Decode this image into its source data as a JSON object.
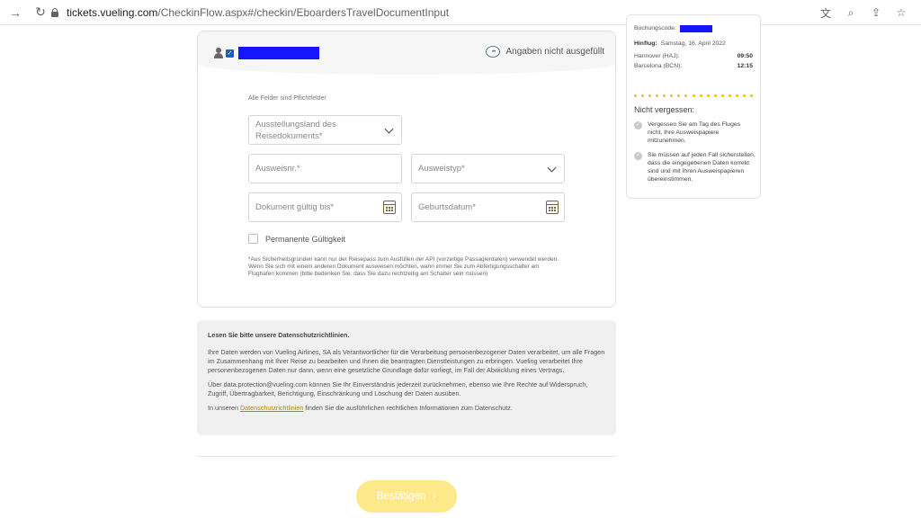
{
  "browser": {
    "url_domain": "tickets.vueling.com",
    "url_path": "/CheckinFlow.aspx#/checkin/EboardersTravelDocumentInput"
  },
  "passenger_card": {
    "status_text": "Angaben nicht ausgefüllt",
    "required_note": "Alle Felder sind Pflichtfelder",
    "fields": {
      "issuing_country": "Ausstellungsland des Reisedokuments*",
      "id_number": "Ausweisnr.*",
      "id_type": "Ausweistyp*",
      "valid_until": "Dokument gültig bis*",
      "birth_date": "Geburtsdatum*"
    },
    "permanent_validity_label": "Permanente Gültigkeit",
    "disclaimer": "*Aus Sicherheitsgründen kann nur der Reisepass zum Ausfüllen der API (vorzeitige Passagierdaten) verwendet werden. Wenn Sie sich mit einem anderen Dokument ausweisen möchten, wann immer Sie zum Abfertigungsschalter am Flughafen kommen (bitte bedenken Sie, dass Sie dazu rechtzeitig am Schalter sein müssen)"
  },
  "privacy": {
    "title": "Lesen Sie bitte unsere Datenschutzrichtlinien.",
    "para1": "Ihre Daten werden von Vueling Airlines, SA als Verantwortlicher für die Verarbeitung personenbezogener Daten verarbeitet, um alle Fragen im Zusammenhang mit Ihrer Reise zu bearbeiten und Ihnen die beantragten Dienstleistungen zu erbringen. Vueling verarbeitet Ihre personenbezogenen Daten nur dann, wenn eine gesetzliche Grundlage dafür vorliegt, im Fall der Abwicklung eines Vertrags.",
    "para2": "Über data.protection@vueling.com können Sie Ihr Einverständnis jederzeit zurücknehmen, ebenso wie Ihre Rechte auf Widerspruch, Zugriff, Übertragbarkeit, Berichtigung, Einschränkung und Löschung der Daten ausüben.",
    "para3_prefix": "In unseren ",
    "para3_link": "Datenschutzrichtlinien",
    "para3_suffix": " finden Sie die ausführlichen rechtlichen Informationen zum Datenschutz."
  },
  "confirm_button": "Bestätigen",
  "sidebar": {
    "booking_code_label": "Buchungscode:",
    "outbound_label": "Hinflug:",
    "outbound_date": "Samstag, 16. April 2022",
    "origin": "Hannover (HAJ):",
    "origin_time": "09:50",
    "destination": "Barcelona (BCN):",
    "destination_time": "12:15",
    "reminder_title": "Nicht vergessen:",
    "tips": [
      "Vergessen Sie am Tag des Fluges nicht, Ihre Ausweispapiere mitzunehmen.",
      "Sie müssen auf jeden Fall sicherstellen, dass die eingegebenen Daten korrekt sind und mit Ihren Ausweispapieren übereinstimmen."
    ]
  }
}
